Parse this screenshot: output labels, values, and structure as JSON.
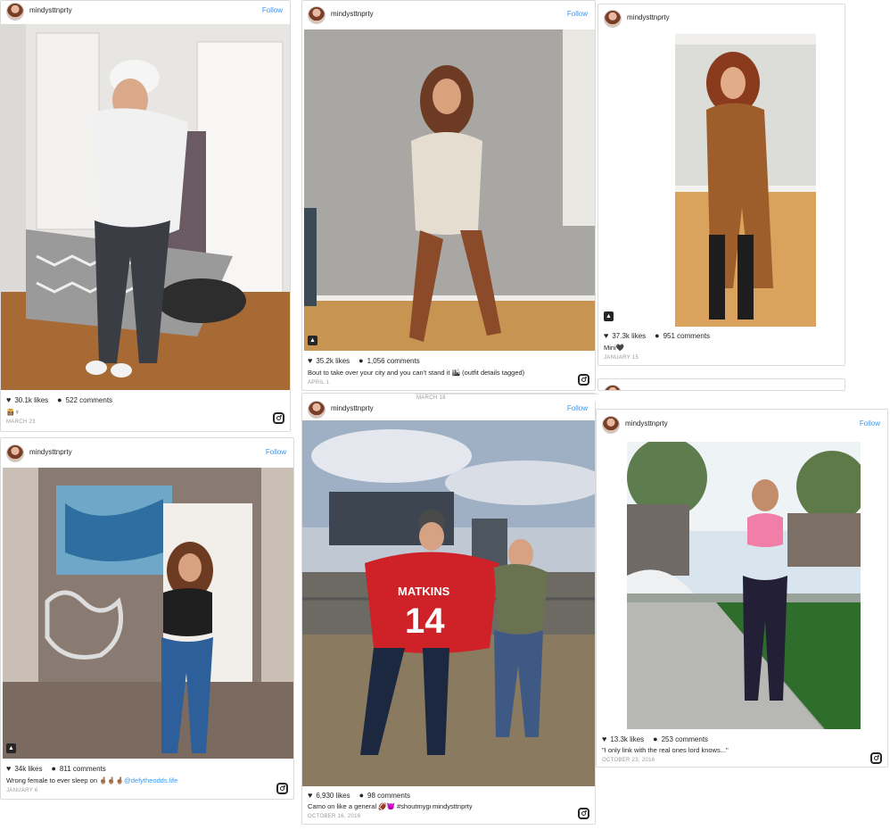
{
  "posts": [
    {
      "user": "mindysttnprty",
      "follow": "Follow",
      "likes": "30.1k likes",
      "comments": "522 comments",
      "caption": "👸🏽♀",
      "date": "MARCH 23"
    },
    {
      "user": "mindysttnprty",
      "follow": "Follow",
      "likes": "35.2k likes",
      "comments": "1,056 comments",
      "caption": "Bout to take over your city and you can't stand it 🏙 (outfit details tagged)",
      "date": "APRIL 1"
    },
    {
      "user": "mindysttnprty",
      "follow": "",
      "likes": "37.3k likes",
      "comments": "951 comments",
      "caption": "Mini🖤",
      "date": "JANUARY 15"
    },
    {
      "user": "mindysttnprty",
      "follow": "Follow",
      "likes": "34k likes",
      "comments": "811 comments",
      "caption": "Wrong female to ever sleep on 🤞🏽🤞🏽🤞🏽",
      "caption_link": "@defytheodds.life",
      "date": "JANUARY 6"
    },
    {
      "user": "mindysttnprty",
      "follow": "Follow",
      "likes": "6,930 likes",
      "comments": "98 comments",
      "caption": "Camo on like a general 🏈😈 #shoutmyguys",
      "date": "OCTOBER 16, 2016"
    },
    {
      "user": "mindysttnprty",
      "follow": "Follow",
      "likes": "13.3k likes",
      "comments": "253 comments",
      "caption": "\"I only link with the real ones lord knows...\"",
      "date": "OCTOBER 23, 2016"
    }
  ],
  "fragments": {
    "date": "MARCH 18",
    "user": "mindysttnprty"
  },
  "icons": {
    "heart": "heart-icon",
    "comment": "comment-icon",
    "instagram": "instagram-icon",
    "tag": "user-tag-icon"
  }
}
